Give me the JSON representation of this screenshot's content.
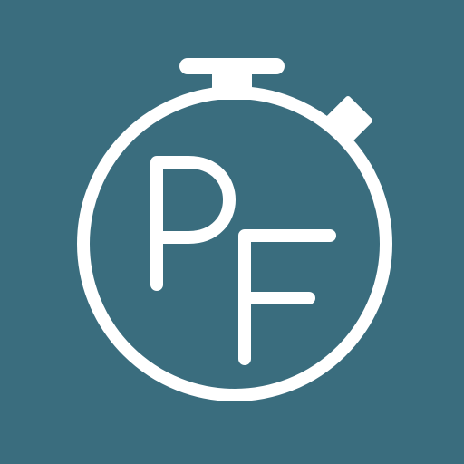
{
  "icon": {
    "name": "stopwatch-icon",
    "monogram": "PF",
    "background_color": "#3a6d7e",
    "foreground_color": "#ffffff"
  }
}
